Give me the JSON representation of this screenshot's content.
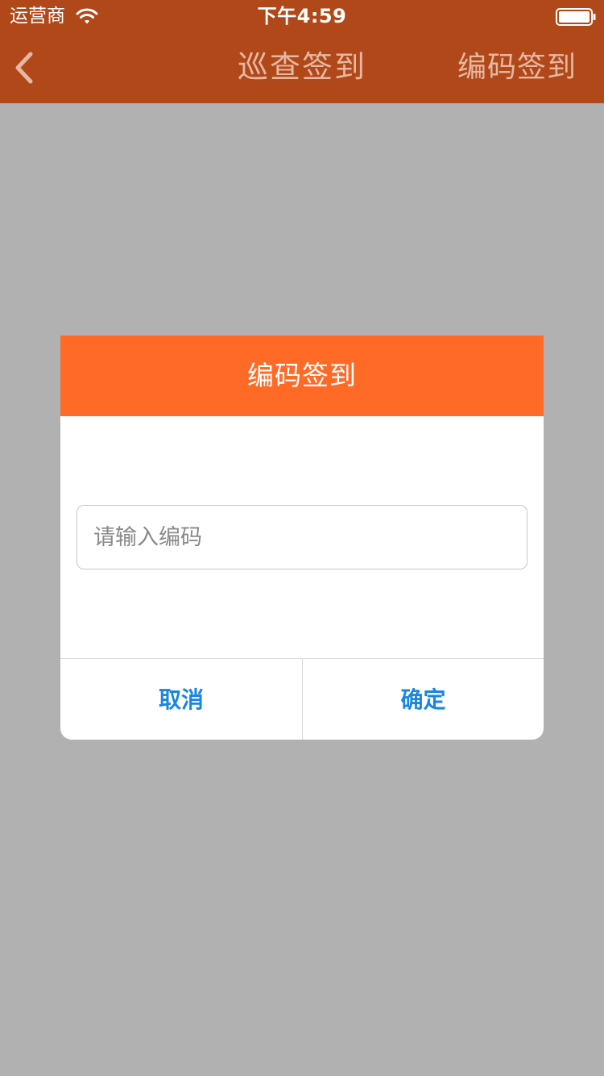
{
  "status_bar": {
    "carrier": "运营商",
    "time": "下午4:59",
    "wifi_icon": "wifi-icon",
    "battery_icon": "battery-icon"
  },
  "nav": {
    "back_icon": "chevron-left-icon",
    "title": "巡查签到",
    "right_button": "编码签到"
  },
  "dialog": {
    "title": "编码签到",
    "input": {
      "value": "",
      "placeholder": "请输入编码"
    },
    "cancel_label": "取消",
    "confirm_label": "确定"
  },
  "colors": {
    "nav_bar": "#b14819",
    "overlay_background": "#b1b1b1",
    "dialog_header": "#ff6a26",
    "button_text": "#1a86e0"
  }
}
